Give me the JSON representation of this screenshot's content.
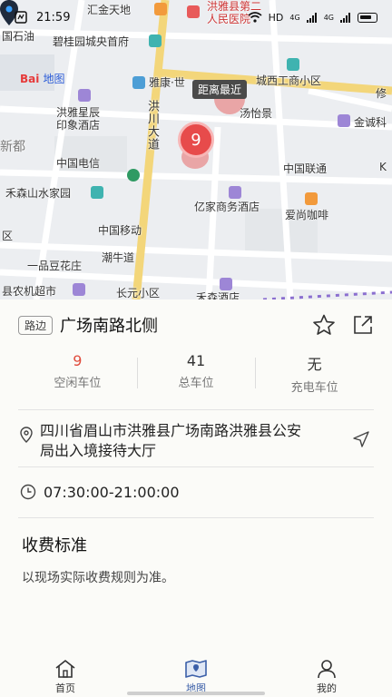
{
  "status_bar": {
    "time": "21:59",
    "network": "HD",
    "signal_1": "4G",
    "signal_2": "4G"
  },
  "map": {
    "brand": "Bai",
    "brand_suffix": "地图",
    "distance_tag": "距离最近",
    "cluster_count": "9",
    "labels": {
      "huijin": "汇金天地",
      "hongya_hosp": "洪雅县第二\n人民医院",
      "shiyou": "国石油",
      "biguiyuan": "碧桂园城央首府",
      "yakang": "雅康·世",
      "chengxi": "城西工商小区",
      "xiu": "修",
      "hongya_hotel_1": "洪雅星辰",
      "hongya_hotel_2": "印象酒店",
      "yiyijing": "汤怡景",
      "jincheng": "金诚科",
      "xindu": "新都",
      "hongchuan": "洪川大道",
      "dianxin": "中国电信",
      "liantong": "中国联通",
      "hesen": "禾森山水家园",
      "yijia": "亿家商务酒店",
      "aishang": "爱尚咖啡",
      "yidong": "中国移动",
      "qu": "区",
      "chaoniu": "潮牛道",
      "yipin": "一品豆花庄",
      "nongji": "县农机超市",
      "changyuan": "长元小区",
      "hesen_hotel": "禾森酒店",
      "k": "K"
    }
  },
  "detail": {
    "tag": "路边",
    "title": "广场南路北侧",
    "stats": [
      {
        "value": "9",
        "label": "空闲车位"
      },
      {
        "value": "41",
        "label": "总车位"
      },
      {
        "value": "无",
        "label": "充电车位"
      }
    ],
    "address": "四川省眉山市洪雅县广场南路洪雅县公安局出入境接待大厅",
    "hours": "07:30:00-21:00:00",
    "fee_title": "收费标准",
    "fee_text": "以现场实际收费规则为准。"
  },
  "nav": {
    "items": [
      {
        "label": "首页",
        "icon": "home-icon"
      },
      {
        "label": "地图",
        "icon": "map-icon"
      },
      {
        "label": "我的",
        "icon": "user-icon"
      }
    ],
    "active_index": 1
  },
  "colors": {
    "accent_red": "#e04b3c",
    "nav_active": "#3b5fa8",
    "road_yellow": "#f3d67a"
  }
}
